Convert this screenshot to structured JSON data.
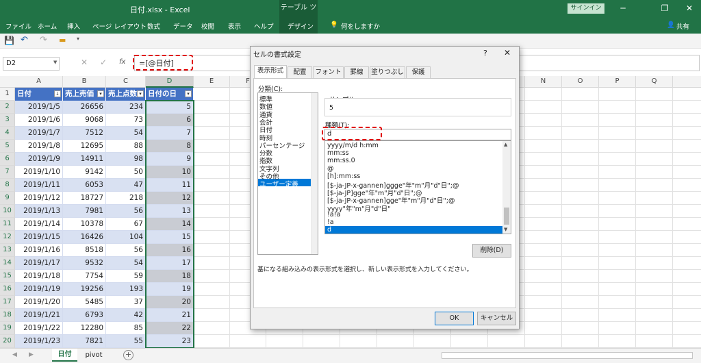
{
  "window": {
    "title": "日付.xlsx  -  Excel",
    "table_tools": "テーブル ツール",
    "signin": "サインイン",
    "min": "─",
    "restore": "❐",
    "close": "✕"
  },
  "ribbon": {
    "tabs": [
      "ファイル",
      "ホーム",
      "挿入",
      "ページ レイアウト",
      "数式",
      "データ",
      "校閲",
      "表示",
      "ヘルプ",
      "デザイン"
    ],
    "tell_me": "何をしますか",
    "share": "共有"
  },
  "formula_bar": {
    "name_box": "D2",
    "fx": "fx",
    "formula": "=[@日付]"
  },
  "columns": [
    "A",
    "B",
    "C",
    "D",
    "E",
    "F",
    "G",
    "H",
    "I",
    "J",
    "K",
    "L",
    "M",
    "N",
    "O",
    "P",
    "Q"
  ],
  "table": {
    "headers": [
      "日付",
      "売上売価",
      "売上点数",
      "日付の日"
    ],
    "rows": [
      [
        "2019/1/5",
        "26656",
        "234",
        "5"
      ],
      [
        "2019/1/6",
        "9068",
        "73",
        "6"
      ],
      [
        "2019/1/7",
        "7512",
        "54",
        "7"
      ],
      [
        "2019/1/8",
        "12695",
        "88",
        "8"
      ],
      [
        "2019/1/9",
        "14911",
        "98",
        "9"
      ],
      [
        "2019/1/10",
        "9142",
        "50",
        "10"
      ],
      [
        "2019/1/11",
        "6053",
        "47",
        "11"
      ],
      [
        "2019/1/12",
        "18727",
        "218",
        "12"
      ],
      [
        "2019/1/13",
        "7981",
        "56",
        "13"
      ],
      [
        "2019/1/14",
        "10378",
        "67",
        "14"
      ],
      [
        "2019/1/15",
        "16426",
        "104",
        "15"
      ],
      [
        "2019/1/16",
        "8518",
        "56",
        "16"
      ],
      [
        "2019/1/17",
        "9532",
        "54",
        "17"
      ],
      [
        "2019/1/18",
        "7754",
        "59",
        "18"
      ],
      [
        "2019/1/19",
        "19256",
        "193",
        "19"
      ],
      [
        "2019/1/20",
        "5485",
        "37",
        "20"
      ],
      [
        "2019/1/21",
        "6793",
        "42",
        "21"
      ],
      [
        "2019/1/22",
        "12280",
        "85",
        "22"
      ],
      [
        "2019/1/23",
        "7821",
        "55",
        "23"
      ]
    ],
    "row_numbers": [
      "1",
      "2",
      "3",
      "4",
      "5",
      "6",
      "7",
      "8",
      "9",
      "10",
      "11",
      "12",
      "13",
      "14",
      "15",
      "16",
      "17",
      "18",
      "19",
      "20"
    ]
  },
  "sheets": {
    "tabs": [
      "日付",
      "pivot"
    ],
    "add": "+"
  },
  "dialog": {
    "title": "セルの書式設定",
    "help": "?",
    "close": "✕",
    "tabs": [
      "表示形式",
      "配置",
      "フォント",
      "罫線",
      "塗りつぶし",
      "保護"
    ],
    "category_label": "分類(C):",
    "categories": [
      "標準",
      "数値",
      "通貨",
      "会計",
      "日付",
      "時刻",
      "パーセンテージ",
      "分数",
      "指数",
      "文字列",
      "その他",
      "ユーザー定義"
    ],
    "sample_label": "サンプル",
    "sample_value": "5",
    "type_label": "種類(T):",
    "type_value": "d",
    "types": [
      "yyyy/m/d h:mm",
      "mm:ss",
      "mm:ss.0",
      "@",
      "[h]:mm:ss",
      "[$-ja-JP-x-gannen]ggge\"年\"m\"月\"d\"日\";@",
      "[$-ja-JP]gge\"年\"m\"月\"d\"日\";@",
      "[$-ja-JP-x-gannen]gge\"年\"m\"月\"d\"日\";@",
      "yyyy\"年\"m\"月\"d\"日\"",
      "!a!a",
      "!a",
      "d"
    ],
    "delete_button": "削除(D)",
    "description": "基になる組み込みの表示形式を選択し、新しい表示形式を入力してください。",
    "ok": "OK",
    "cancel": "キャンセル"
  }
}
